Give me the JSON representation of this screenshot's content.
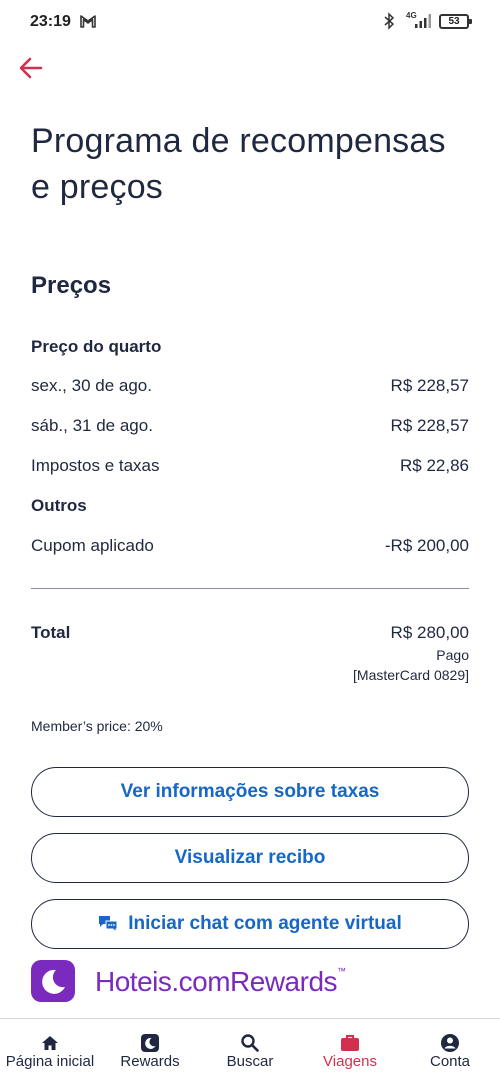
{
  "status_bar": {
    "time": "23:19",
    "network": "4G",
    "battery": "53"
  },
  "page": {
    "title": "Programa de recompensas e preços",
    "section_title": "Preços"
  },
  "prices": {
    "room_price_heading": "Preço do quarto",
    "rows": [
      {
        "label": "sex., 30 de ago.",
        "value": "R$ 228,57"
      },
      {
        "label": "sáb., 31 de ago.",
        "value": "R$ 228,57"
      },
      {
        "label": "Impostos e taxas",
        "value": "R$ 22,86"
      }
    ],
    "others_heading": "Outros",
    "coupon": {
      "label": "Cupom aplicado",
      "value": "-R$ 200,00"
    }
  },
  "total": {
    "label": "Total",
    "value": "R$ 280,00",
    "status": "Pago",
    "card": "[MasterCard 0829]"
  },
  "member_price": "Member’s price: 20%",
  "buttons": {
    "taxes": "Ver informações sobre taxas",
    "receipt": "Visualizar recibo",
    "chat": "Iniciar chat com agente virtual"
  },
  "rewards_brand": {
    "part1": "Hoteis.com",
    "part2": "Rewards",
    "tm": "™"
  },
  "bottom_nav": [
    {
      "label": "Página inicial",
      "icon": "home-icon"
    },
    {
      "label": "Rewards",
      "icon": "rewards-icon"
    },
    {
      "label": "Buscar",
      "icon": "search-icon"
    },
    {
      "label": "Viagens",
      "icon": "briefcase-icon",
      "active": true
    },
    {
      "label": "Conta",
      "icon": "account-icon"
    }
  ],
  "colors": {
    "accent_link": "#1667c6",
    "active_nav": "#d32f4f",
    "brand_purple": "#7a2bbd",
    "text": "#1f2840"
  }
}
